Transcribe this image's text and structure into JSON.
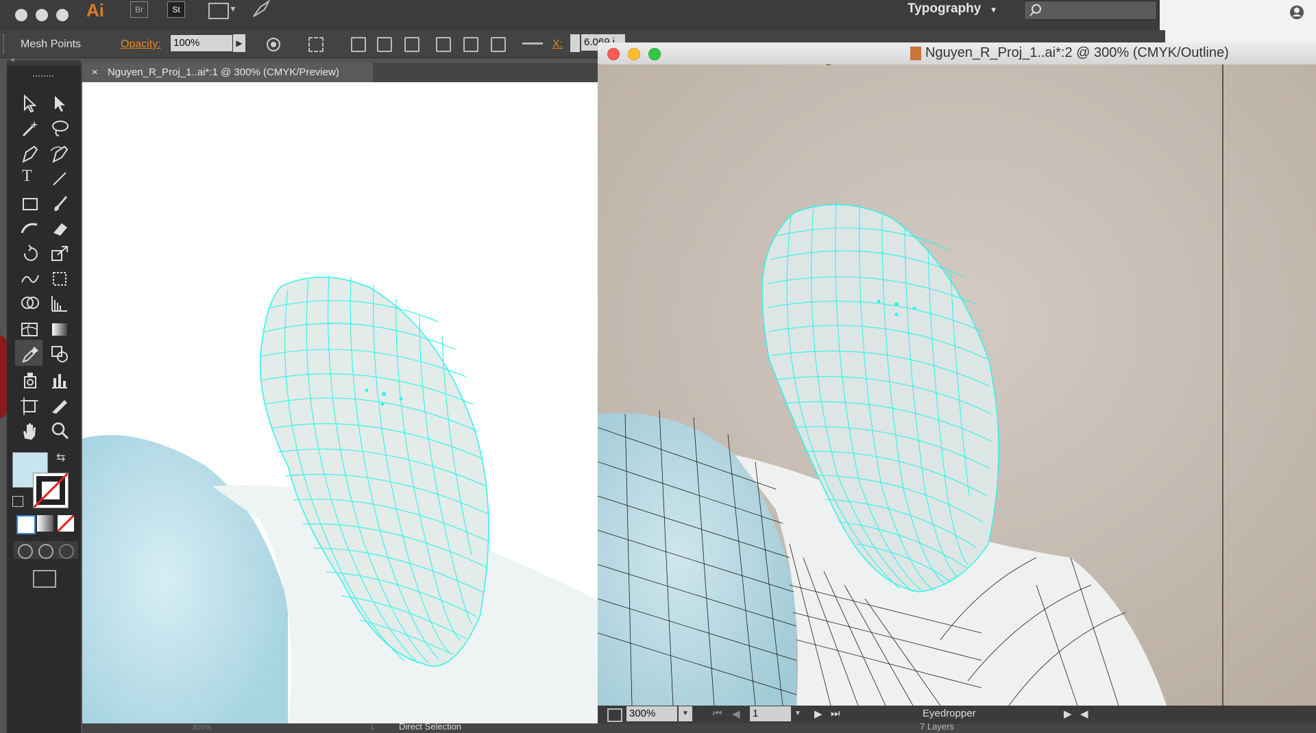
{
  "app": {
    "logo": "Ai",
    "badges": [
      "Br",
      "St"
    ],
    "workspace": "Typography",
    "workspace_caret": "▾"
  },
  "control_bar": {
    "tool_label": "Mesh Points",
    "opacity_label": "Opacity:",
    "opacity_value": "100%",
    "x_label": "X:",
    "x_value": "6.069 i"
  },
  "document_1": {
    "tab_close": "×",
    "tab_title": "Nguyen_R_Proj_1..ai*:1 @ 300% (CMYK/Preview)",
    "zoom": "300%",
    "page": "1",
    "status_tool": "Direct Selection"
  },
  "document_2": {
    "title": "Nguyen_R_Proj_1..ai*:2 @ 300% (CMYK/Outline)",
    "zoom": "300%",
    "page": "1",
    "status_tool": "Eyedropper",
    "layers": "7 Layers"
  },
  "colors": {
    "mesh": "#2ef2ec",
    "fill_swatch": "#c7e5ef",
    "accent_orange": "#e08a2b"
  }
}
